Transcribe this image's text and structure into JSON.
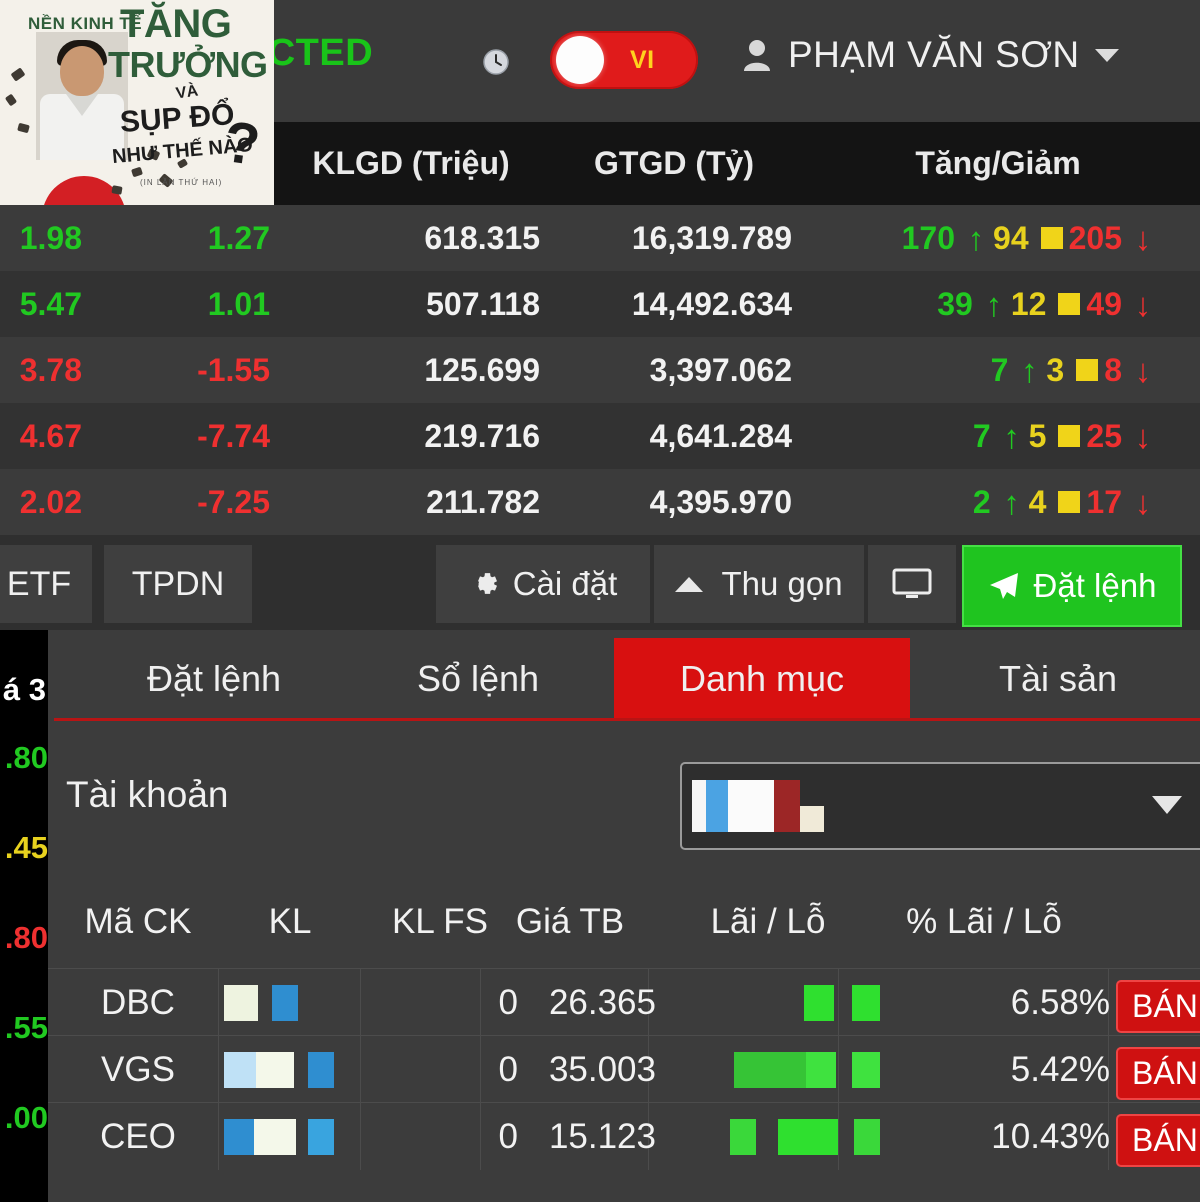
{
  "header": {
    "connection_status": "NNECTED",
    "clock_icon": "clock-icon",
    "language_toggle": {
      "label": "VI",
      "icon": "toggle-switch-icon"
    },
    "user": {
      "icon": "user-icon",
      "name": "PHẠM VĂN SƠN",
      "caret": "chevron-down-icon"
    }
  },
  "index_table": {
    "columns": [
      "",
      "",
      "KLGD (Triệu)",
      "GTGD (Tỷ)",
      "Tăng/Giảm"
    ],
    "rows": [
      {
        "change": "1.98",
        "pct": "1.27",
        "change_dir": "up",
        "klgd": "618.315",
        "gtgd": "16,319.789",
        "adv": "170",
        "ref": "94",
        "dec": "205"
      },
      {
        "change": "5.47",
        "pct": "1.01",
        "change_dir": "up",
        "klgd": "507.118",
        "gtgd": "14,492.634",
        "adv": "39",
        "ref": "12",
        "dec": "49"
      },
      {
        "change": "3.78",
        "pct": "-1.55",
        "change_dir": "down",
        "klgd": "125.699",
        "gtgd": "3,397.062",
        "adv": "7",
        "ref": "3",
        "dec": "8"
      },
      {
        "change": "4.67",
        "pct": "-7.74",
        "change_dir": "down",
        "klgd": "219.716",
        "gtgd": "4,641.284",
        "adv": "7",
        "ref": "5",
        "dec": "25"
      },
      {
        "change": "2.02",
        "pct": "-7.25",
        "change_dir": "down",
        "klgd": "211.782",
        "gtgd": "4,395.970",
        "adv": "2",
        "ref": "4",
        "dec": "17"
      }
    ],
    "arrow_up": "↑",
    "arrow_down": "↓"
  },
  "toolbar": {
    "tabs": [
      {
        "label": "ETF"
      },
      {
        "label": "TPDN"
      }
    ],
    "settings_label": "Cài đặt",
    "collapse_label": "Thu gọn",
    "monitor_icon": "monitor-icon",
    "order_label": "Đặt lệnh"
  },
  "left_strip": {
    "header": "á 3",
    "cells": [
      {
        "value": ".80",
        "color": "up"
      },
      {
        "value": ".45",
        "color": "ref"
      },
      {
        "value": ".80",
        "color": "down"
      },
      {
        "value": ".55",
        "color": "up"
      },
      {
        "value": ".00",
        "color": "up"
      }
    ]
  },
  "panel": {
    "tabs": [
      {
        "label": "Đặt lệnh",
        "active": false
      },
      {
        "label": "Sổ lệnh",
        "active": false
      },
      {
        "label": "Danh mục",
        "active": true
      },
      {
        "label": "Tài sản",
        "active": false
      }
    ],
    "account": {
      "label": "Tài khoản",
      "value_masked": true,
      "caret": "chevron-down-icon"
    },
    "portfolio": {
      "columns": [
        "Mã CK",
        "KL",
        "KL FS",
        "Giá TB",
        "Lãi / Lỗ",
        "% Lãi / Lỗ"
      ],
      "rows": [
        {
          "symbol": "DBC",
          "kl_masked": true,
          "kl_fs": "0",
          "gia_tb": "26.365",
          "pnl_masked": true,
          "pnl_pct": "6.58%",
          "action": "BÁN"
        },
        {
          "symbol": "VGS",
          "kl_masked": true,
          "kl_fs": "0",
          "gia_tb": "35.003",
          "pnl_masked": true,
          "pnl_pct": "5.42%",
          "action": "BÁN"
        },
        {
          "symbol": "CEO",
          "kl_masked": true,
          "kl_fs": "0",
          "gia_tb": "15.123",
          "pnl_masked": true,
          "pnl_pct": "10.43%",
          "action": "BÁN"
        }
      ]
    }
  },
  "overlay": {
    "line1": "NỀN KINH TẾ",
    "tang": "TĂNG",
    "truong": "TRƯỞNG",
    "va": "VÀ",
    "sup_do": "SỤP ĐỔ",
    "nhu_the_nao": "NHƯ THẾ NÀO",
    "question": "?",
    "small": "(IN LẦN THỨ HAI)"
  },
  "colors": {
    "up": "#21c921",
    "down": "#ef3030",
    "reference": "#e8d21e",
    "accent_red": "#d81010",
    "accent_green": "#1fc41f",
    "bg_dark": "#2b2b2b",
    "panel_bg": "#3c3c3c"
  }
}
